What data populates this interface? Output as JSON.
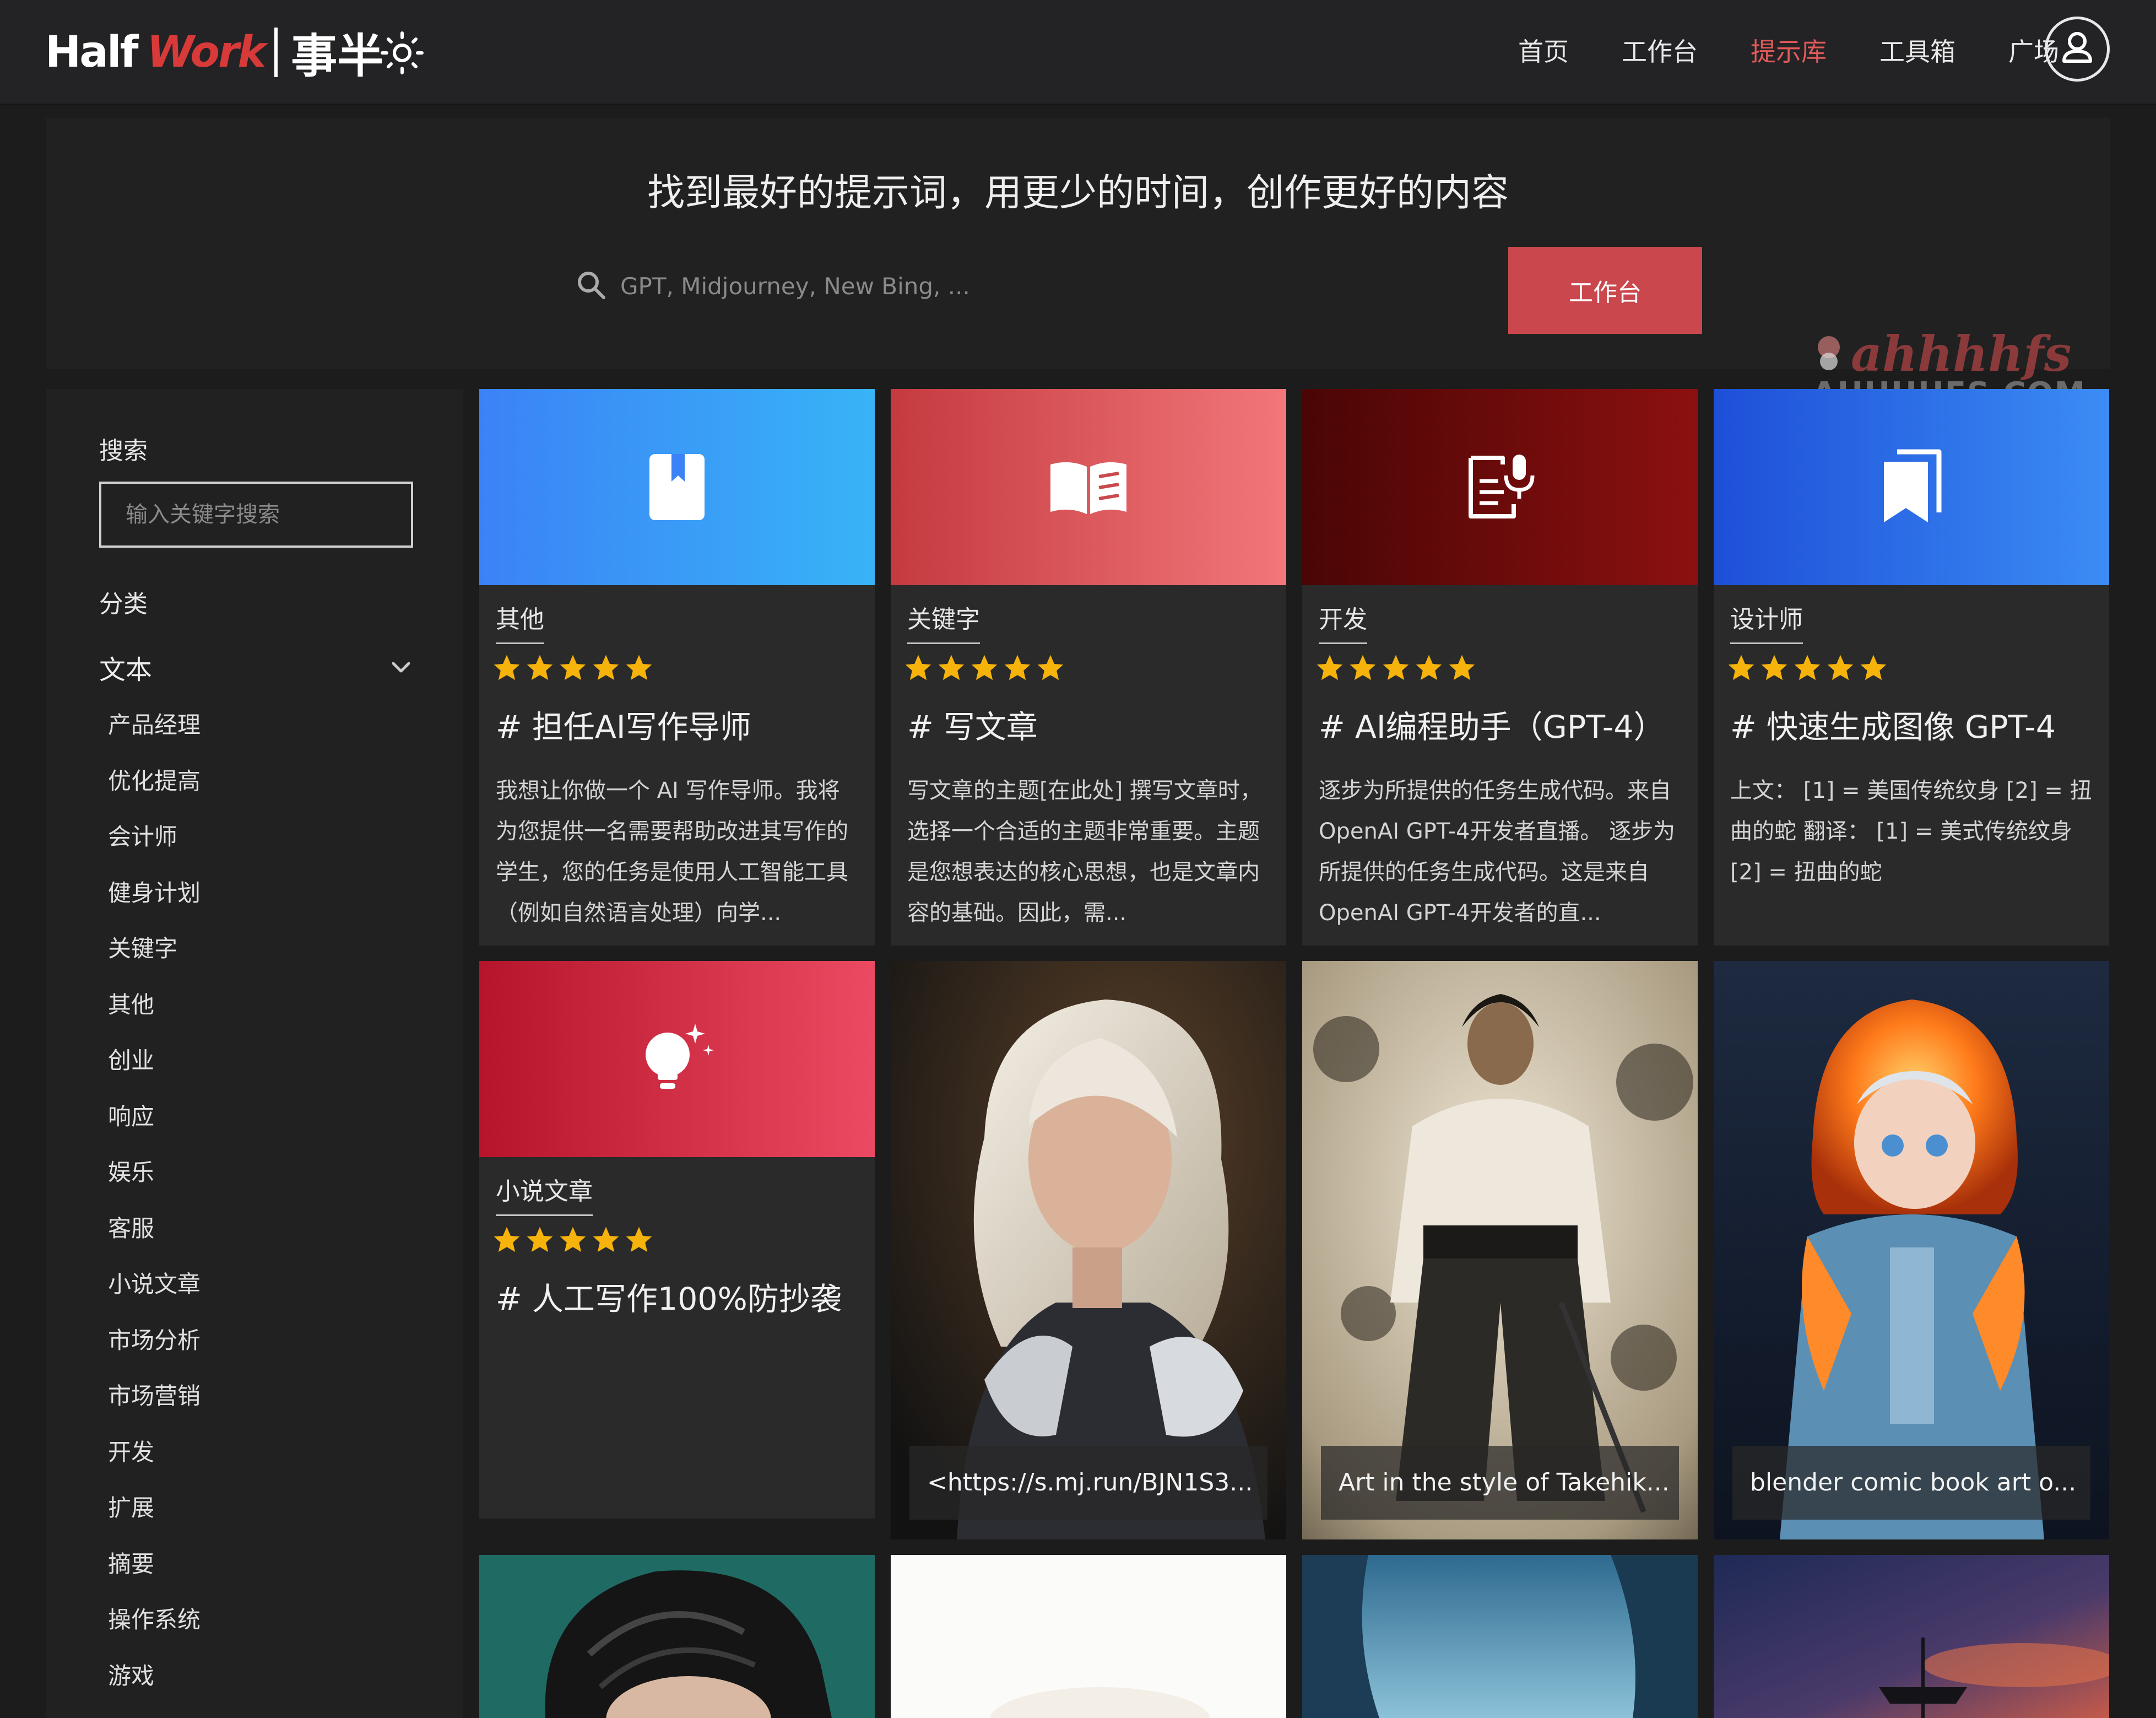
{
  "header": {
    "logo_half": "Half",
    "logo_work": "Work",
    "logo_cn": "事半",
    "theme_icon": "sun-icon",
    "nav": [
      {
        "label": "首页",
        "active": false
      },
      {
        "label": "工作台",
        "active": false
      },
      {
        "label": "提示库",
        "active": true
      },
      {
        "label": "工具箱",
        "active": false
      },
      {
        "label": "广场",
        "active": false
      }
    ],
    "user_icon": "user-icon"
  },
  "hero": {
    "headline": "找到最好的提示词，用更少的时间，创作更好的内容",
    "search_placeholder": "GPT, Midjourney, New Bing, ...",
    "button_label": "工作台"
  },
  "watermark": {
    "line1": "ahhhhfs",
    "line2": "AHHHHFS.COM"
  },
  "sidebar": {
    "search_label": "搜索",
    "search_placeholder": "输入关键字搜索",
    "category_label": "分类",
    "category_selected": "文本",
    "items": [
      "产品经理",
      "优化提高",
      "会计师",
      "健身计划",
      "关键字",
      "其他",
      "创业",
      "响应",
      "娱乐",
      "客服",
      "小说文章",
      "市场分析",
      "市场营销",
      "开发",
      "扩展",
      "摘要",
      "操作系统",
      "游戏"
    ]
  },
  "cards": [
    {
      "tag": "其他",
      "title": "# 担任AI写作导师",
      "desc": "我想让你做一个 AI 写作导师。我将为您提供一名需要帮助改进其写作的学生，您的任务是使用人工智能工具（例如自然语言处理）向学...",
      "icon": "bookmark-icon",
      "rating": 5,
      "colors": [
        "#3b82f6",
        "#38b4f7"
      ]
    },
    {
      "tag": "关键字",
      "title": "# 写文章",
      "desc": "写文章的主题[在此处] 撰写文章时，选择一个合适的主题非常重要。主题是您想表达的核心思想，也是文章内容的基础。因此，需...",
      "icon": "open-book-icon",
      "rating": 5,
      "colors": [
        "#c43a3f",
        "#f2777a"
      ]
    },
    {
      "tag": "开发",
      "title": "# AI编程助手（GPT-4）",
      "desc": "逐步为所提供的任务生成代码。来自OpenAI GPT-4开发者直播。 逐步为所提供的任务生成代码。这是来自OpenAI GPT-4开发者的直...",
      "icon": "document-mic-icon",
      "rating": 5,
      "colors": [
        "#4a0505",
        "#8c1010"
      ]
    },
    {
      "tag": "设计师",
      "title": "# 快速生成图像 GPT-4",
      "desc": "上文： [1] = 美国传统纹身 [2] = 扭曲的蛇 翻译： [1] = 美式传统纹身 [2] = 扭曲的蛇",
      "icon": "bookmarks-icon",
      "rating": 5,
      "colors": [
        "#1e4fd8",
        "#3b8cf5"
      ]
    },
    {
      "tag": "小说文章",
      "title": "# 人工写作100%防抄袭",
      "desc": "",
      "icon": "lightbulb-icon",
      "rating": 5,
      "colors": [
        "#b5142a",
        "#ec4a62"
      ]
    }
  ],
  "image_cards": [
    {
      "caption": "<https://s.mj.run/BJN1S3...",
      "subject": "silver-haired-cyborg-woman-image"
    },
    {
      "caption": "Art in the style of Takehik...",
      "subject": "samurai-ink-painting-image"
    },
    {
      "caption": "blender comic book art o...",
      "subject": "fire-hooded-girl-image"
    }
  ],
  "bottom_images": [
    {
      "subject": "dark-hair-portrait-image"
    },
    {
      "subject": "white-blank-image"
    },
    {
      "subject": "blue-cave-image"
    },
    {
      "subject": "sunset-ship-image"
    }
  ]
}
